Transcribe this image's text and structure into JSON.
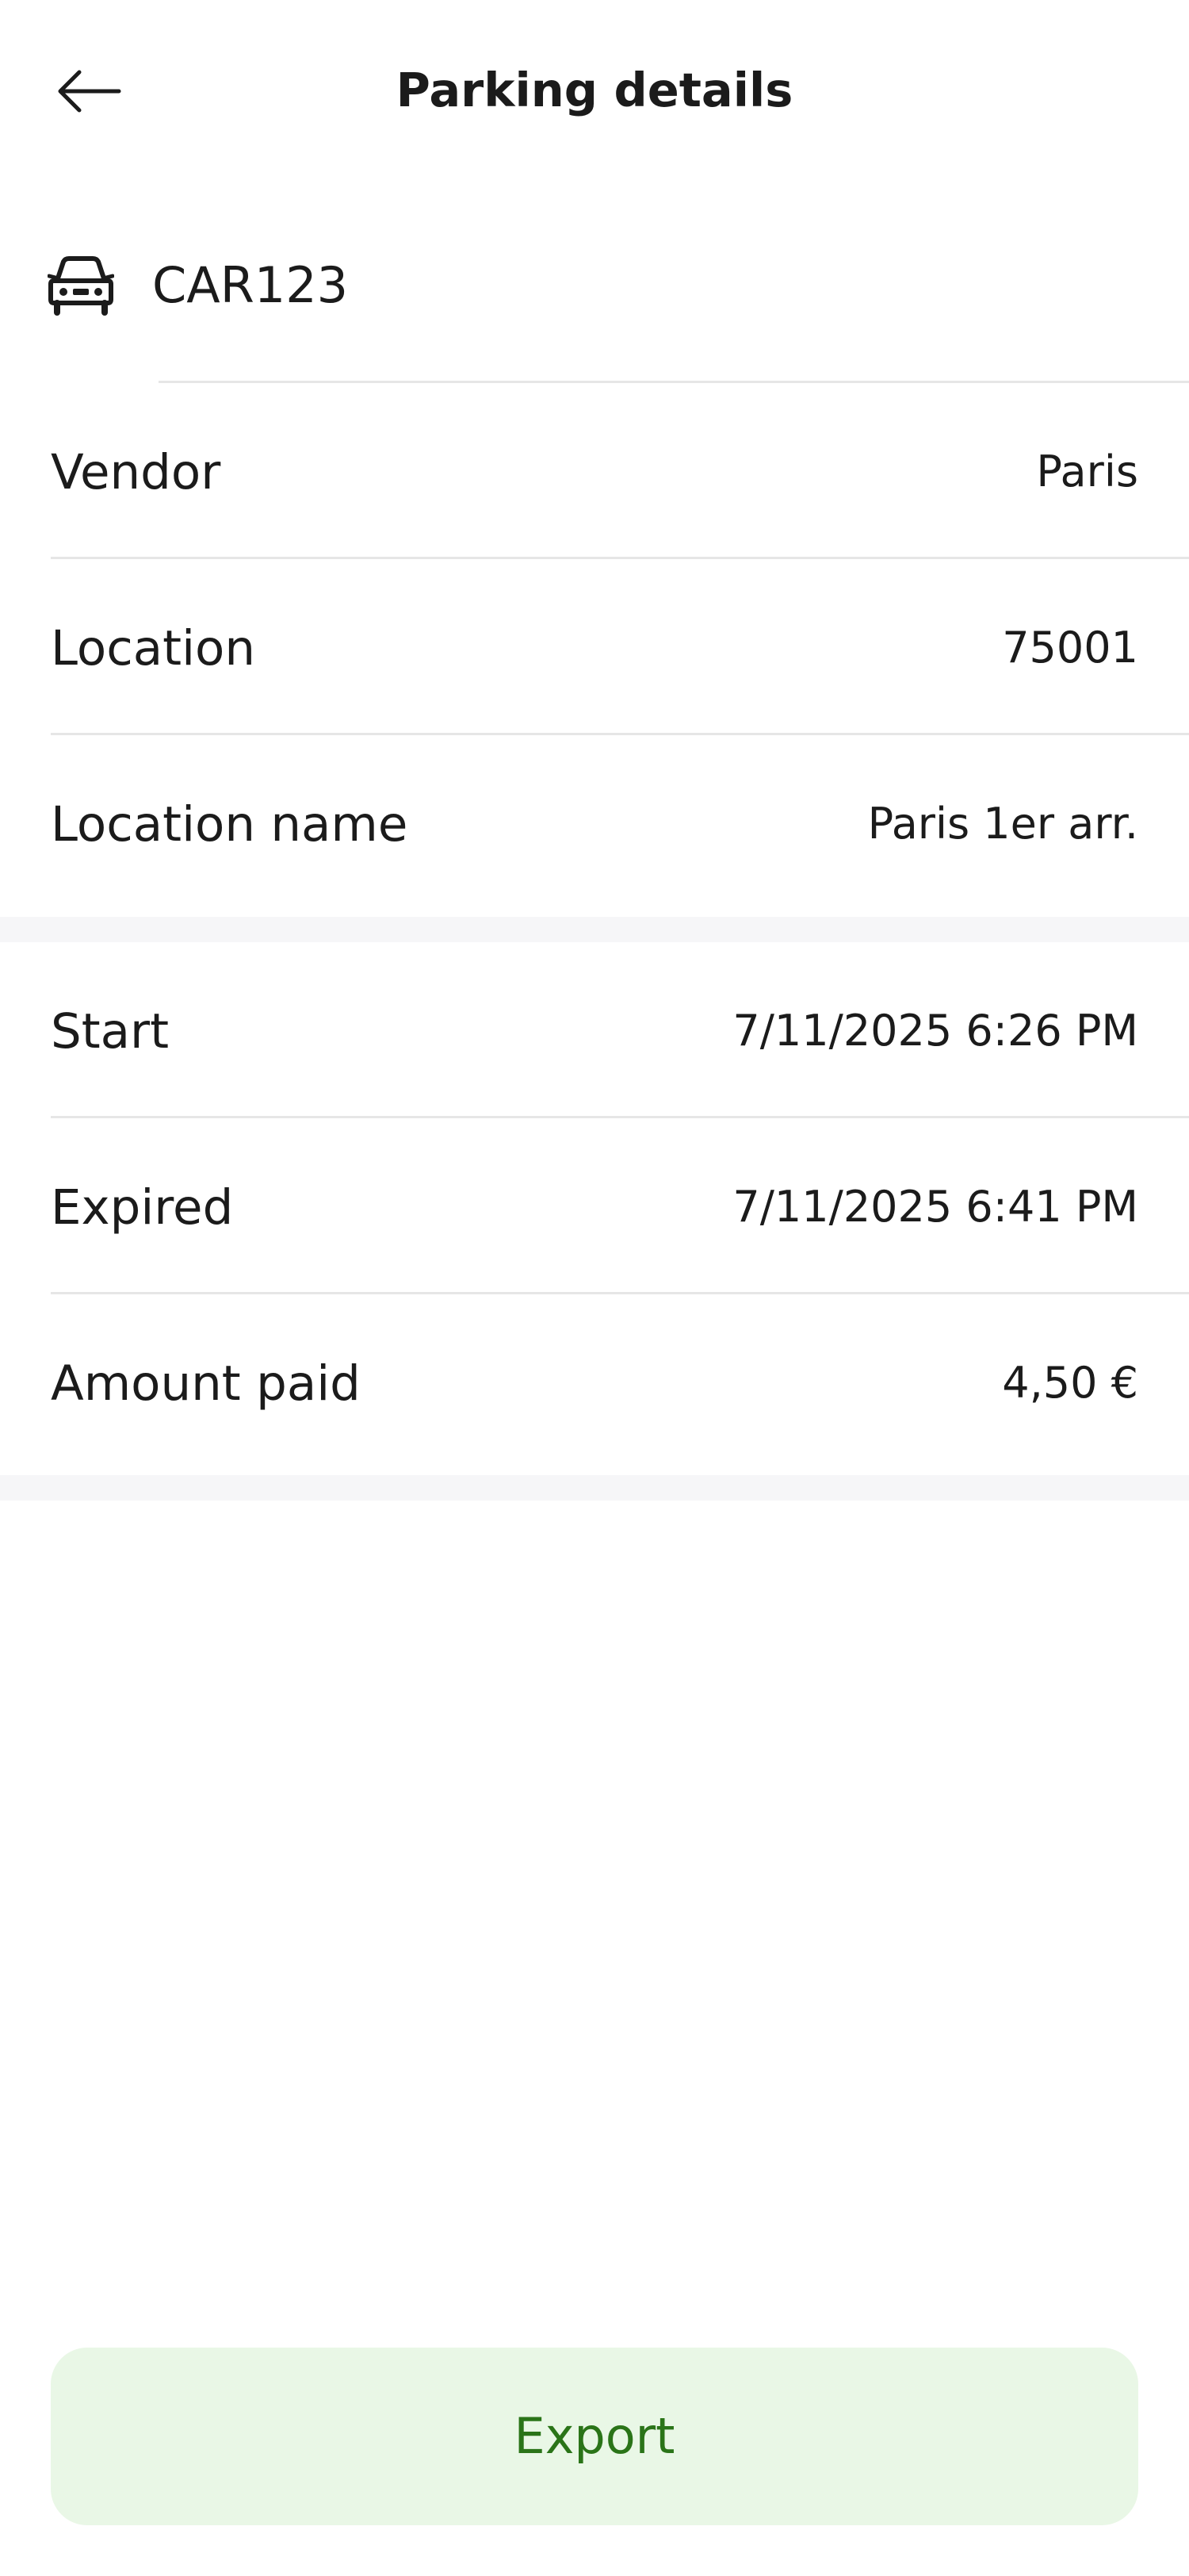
{
  "header": {
    "title": "Parking details",
    "back_icon": "arrow-left-icon"
  },
  "vehicle": {
    "icon": "car-icon",
    "plate": "CAR123"
  },
  "details": {
    "vendor_label": "Vendor",
    "vendor_value": "Paris",
    "location_label": "Location",
    "location_value": "75001",
    "location_name_label": "Location name",
    "location_name_value": "Paris 1er arr."
  },
  "timing": {
    "start_label": "Start",
    "start_value": "7/11/2025 6:26 PM",
    "expired_label": "Expired",
    "expired_value": "7/11/2025 6:41 PM",
    "amount_label": "Amount paid",
    "amount_value": "4,50 €"
  },
  "actions": {
    "export_label": "Export"
  },
  "colors": {
    "accent_text": "#2a7418",
    "accent_bg": "#e9f7e6",
    "divider": "#e6e6e6",
    "section_gap": "#f6f6f8"
  }
}
